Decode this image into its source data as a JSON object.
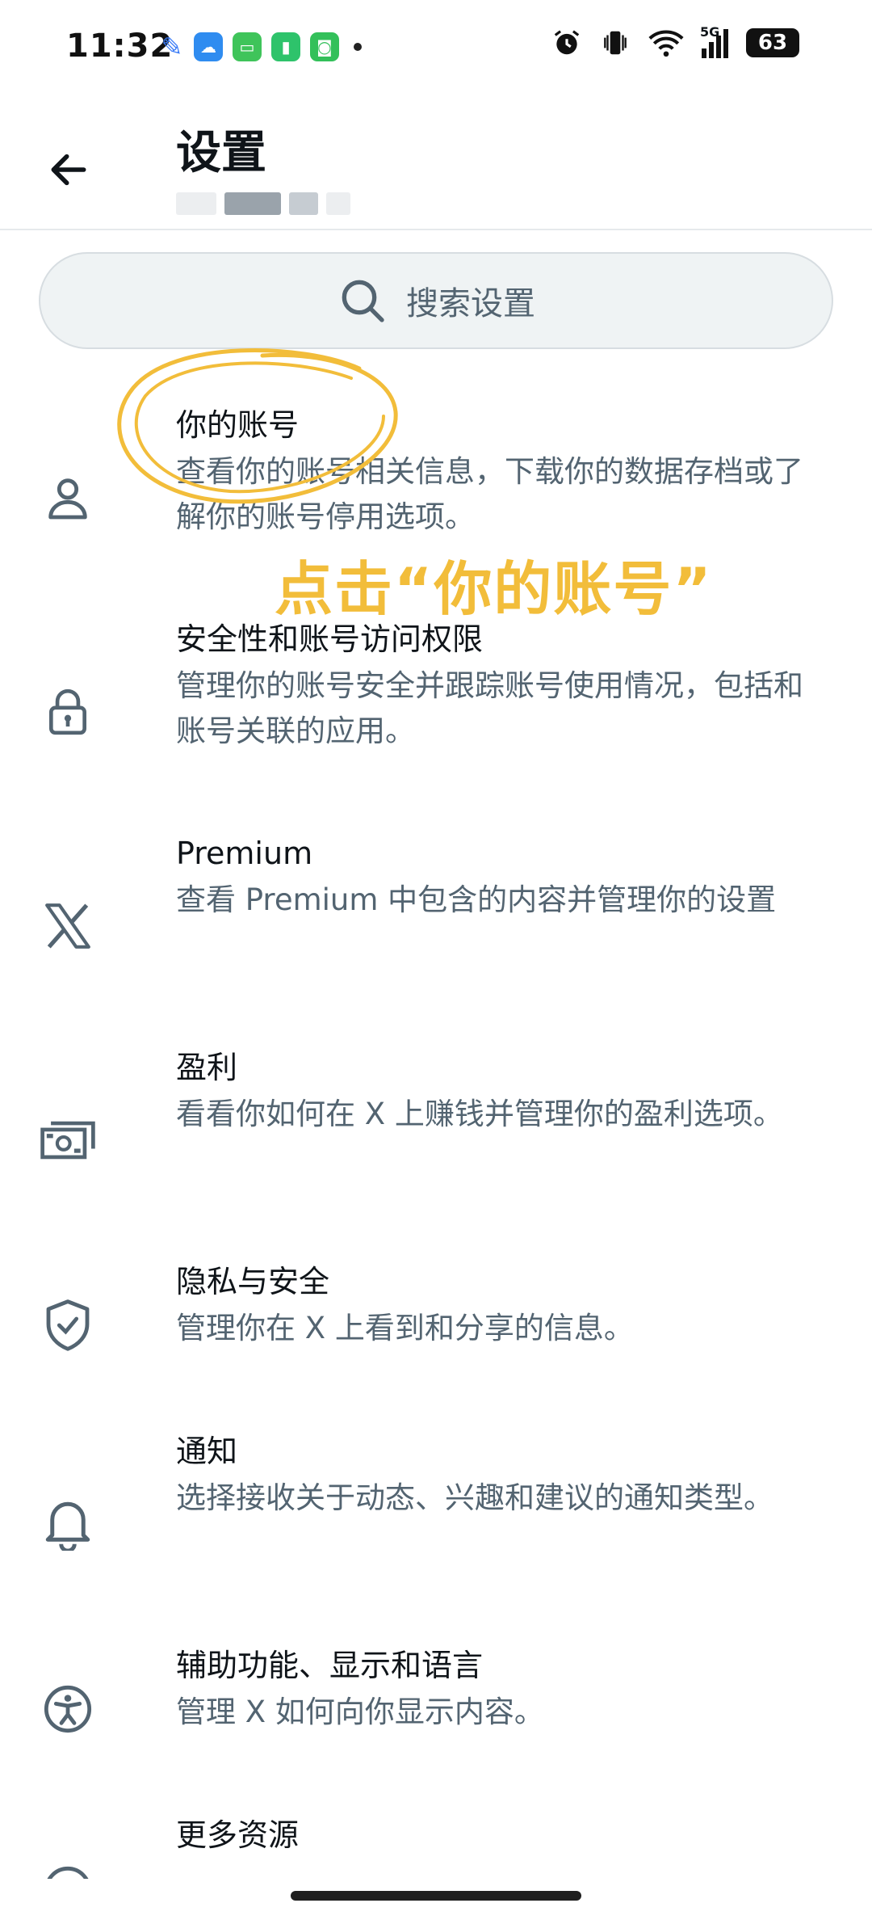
{
  "status_bar": {
    "time": "11:32",
    "network": "5G",
    "battery": "63",
    "notification_icons": [
      "pen-icon",
      "weather-icon",
      "messages-icon",
      "battery-saver-icon",
      "shop-icon",
      "more-dot-icon"
    ],
    "system_icons": [
      "alarm-icon",
      "vibrate-icon",
      "wifi-icon",
      "signal-icon"
    ]
  },
  "header": {
    "title": "设置"
  },
  "search": {
    "placeholder": "搜索设置"
  },
  "items": [
    {
      "icon": "person-icon",
      "title": "你的账号",
      "desc": "查看你的账号相关信息，下载你的数据存档或了解你的账号停用选项。"
    },
    {
      "icon": "lock-icon",
      "title": "安全性和账号访问权限",
      "desc": "管理你的账号安全并跟踪账号使用情况，包括和账号关联的应用。"
    },
    {
      "icon": "x-logo-icon",
      "title": "Premium",
      "desc": "查看 Premium 中包含的内容并管理你的设置"
    },
    {
      "icon": "money-icon",
      "title": "盈利",
      "desc": "看看你如何在 X 上赚钱并管理你的盈利选项。"
    },
    {
      "icon": "shield-check-icon",
      "title": "隐私与安全",
      "desc": "管理你在 X 上看到和分享的信息。"
    },
    {
      "icon": "bell-icon",
      "title": "通知",
      "desc": "选择接收关于动态、兴趣和建议的通知类型。"
    },
    {
      "icon": "accessibility-icon",
      "title": "辅助功能、显示和语言",
      "desc": "管理 X 如何向你显示内容。"
    },
    {
      "icon": "more-resources-icon",
      "title": "更多资源",
      "desc": ""
    }
  ],
  "annotation": {
    "text": "点击“你的账号”",
    "color": "#f2bd3a"
  },
  "colors": {
    "primary_text": "#0f1419",
    "secondary_text": "#536471",
    "search_bg": "#eff3f4"
  }
}
